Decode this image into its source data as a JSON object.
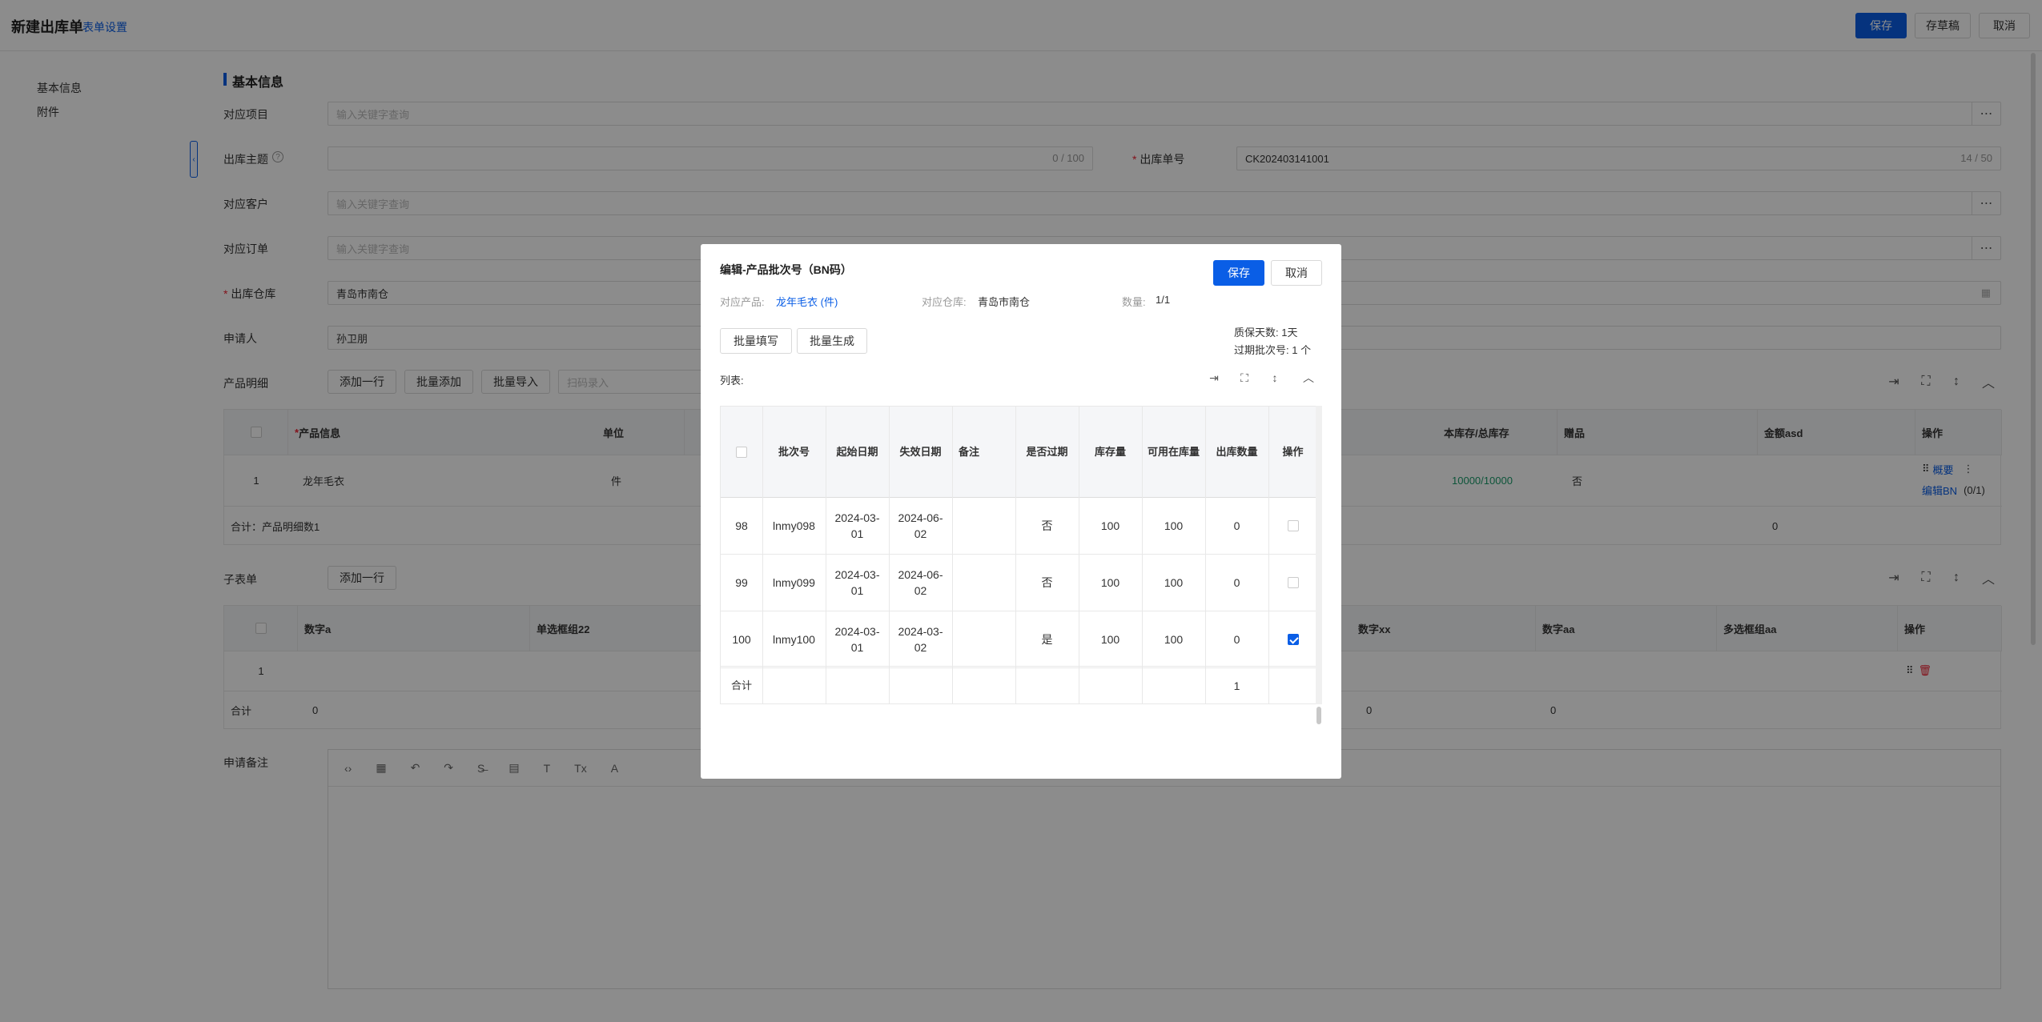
{
  "header": {
    "title": "新建出库单",
    "form_settings": "表单设置",
    "save": "保存",
    "draft": "存草稿",
    "cancel": "取消"
  },
  "sidebar": {
    "items": [
      "基本信息",
      "附件"
    ]
  },
  "section": {
    "basic": "基本信息"
  },
  "form": {
    "project": {
      "label": "对应项目",
      "placeholder": "输入关键字查询"
    },
    "subject": {
      "label": "出库主题",
      "count": "0 / 100"
    },
    "order_no": {
      "label": "出库单号",
      "value": "CK202403141001",
      "count": "14 / 50"
    },
    "customer": {
      "label": "对应客户",
      "placeholder": "输入关键字查询"
    },
    "order": {
      "label": "对应订单",
      "placeholder": "输入关键字查询"
    },
    "warehouse": {
      "label": "出库仓库",
      "value": "青岛市南仓"
    },
    "applicant": {
      "label": "申请人",
      "value": "孙卫朋"
    },
    "detail": {
      "label": "产品明细",
      "add_row": "添加一行",
      "batch_add": "批量添加",
      "batch_import": "批量导入",
      "scan_placeholder": "扫码录入"
    },
    "sub": {
      "label": "子表单",
      "add_row": "添加一行"
    },
    "remark": {
      "label": "申请备注"
    }
  },
  "detail_table": {
    "headers": [
      "产品信息",
      "单位",
      "本库存/总库存",
      "赠品",
      "金额asd",
      "操作"
    ],
    "row": {
      "index": "1",
      "product": "龙年毛衣",
      "unit": "件",
      "stock": "10000",
      "total": "10000",
      "gift": "否",
      "op1": "概要",
      "op2": "编辑BN",
      "op3": "(0/1)"
    },
    "sum_label": "合计：产品明细数1",
    "sum_amount": "0"
  },
  "sub_table": {
    "headers": [
      "数字a",
      "单选框组22",
      "数字xx",
      "数字aa",
      "多选框组aa",
      "操作"
    ],
    "row_index": "1",
    "sum": {
      "label": "合计",
      "a": "0",
      "xx": "0",
      "aa": "0"
    }
  },
  "modal": {
    "title": "编辑-产品批次号（BN码）",
    "save": "保存",
    "cancel": "取消",
    "product_label": "对应产品:",
    "product_value": "龙年毛衣 (件)",
    "warehouse_label": "对应仓库:",
    "warehouse_value": "青岛市南仓",
    "qty_label": "数量:",
    "qty_value": "1/1",
    "shelf_label": "质保天数:",
    "shelf_value": "1天",
    "expired_label": "过期批次号:",
    "expired_value": "1 个",
    "batch_fill": "批量填写",
    "batch_gen": "批量生成",
    "list_label": "列表:",
    "headers": [
      "批次号",
      "起始日期",
      "失效日期",
      "备注",
      "是否过期",
      "库存量",
      "可用在库量",
      "出库数量",
      "操作"
    ],
    "rows": [
      {
        "idx": "98",
        "bn": "lnmy098",
        "start": "2024-03-01",
        "end": "2024-06-02",
        "note": "",
        "expired": "否",
        "stock": "100",
        "avail": "100",
        "out": "0",
        "checked": false
      },
      {
        "idx": "99",
        "bn": "lnmy099",
        "start": "2024-03-01",
        "end": "2024-06-02",
        "note": "",
        "expired": "否",
        "stock": "100",
        "avail": "100",
        "out": "0",
        "checked": false
      },
      {
        "idx": "100",
        "bn": "lnmy100",
        "start": "2024-03-01",
        "end": "2024-03-02",
        "note": "",
        "expired": "是",
        "stock": "100",
        "avail": "100",
        "out": "0",
        "checked": true
      }
    ],
    "sum_label": "合计",
    "sum_out": "1"
  }
}
